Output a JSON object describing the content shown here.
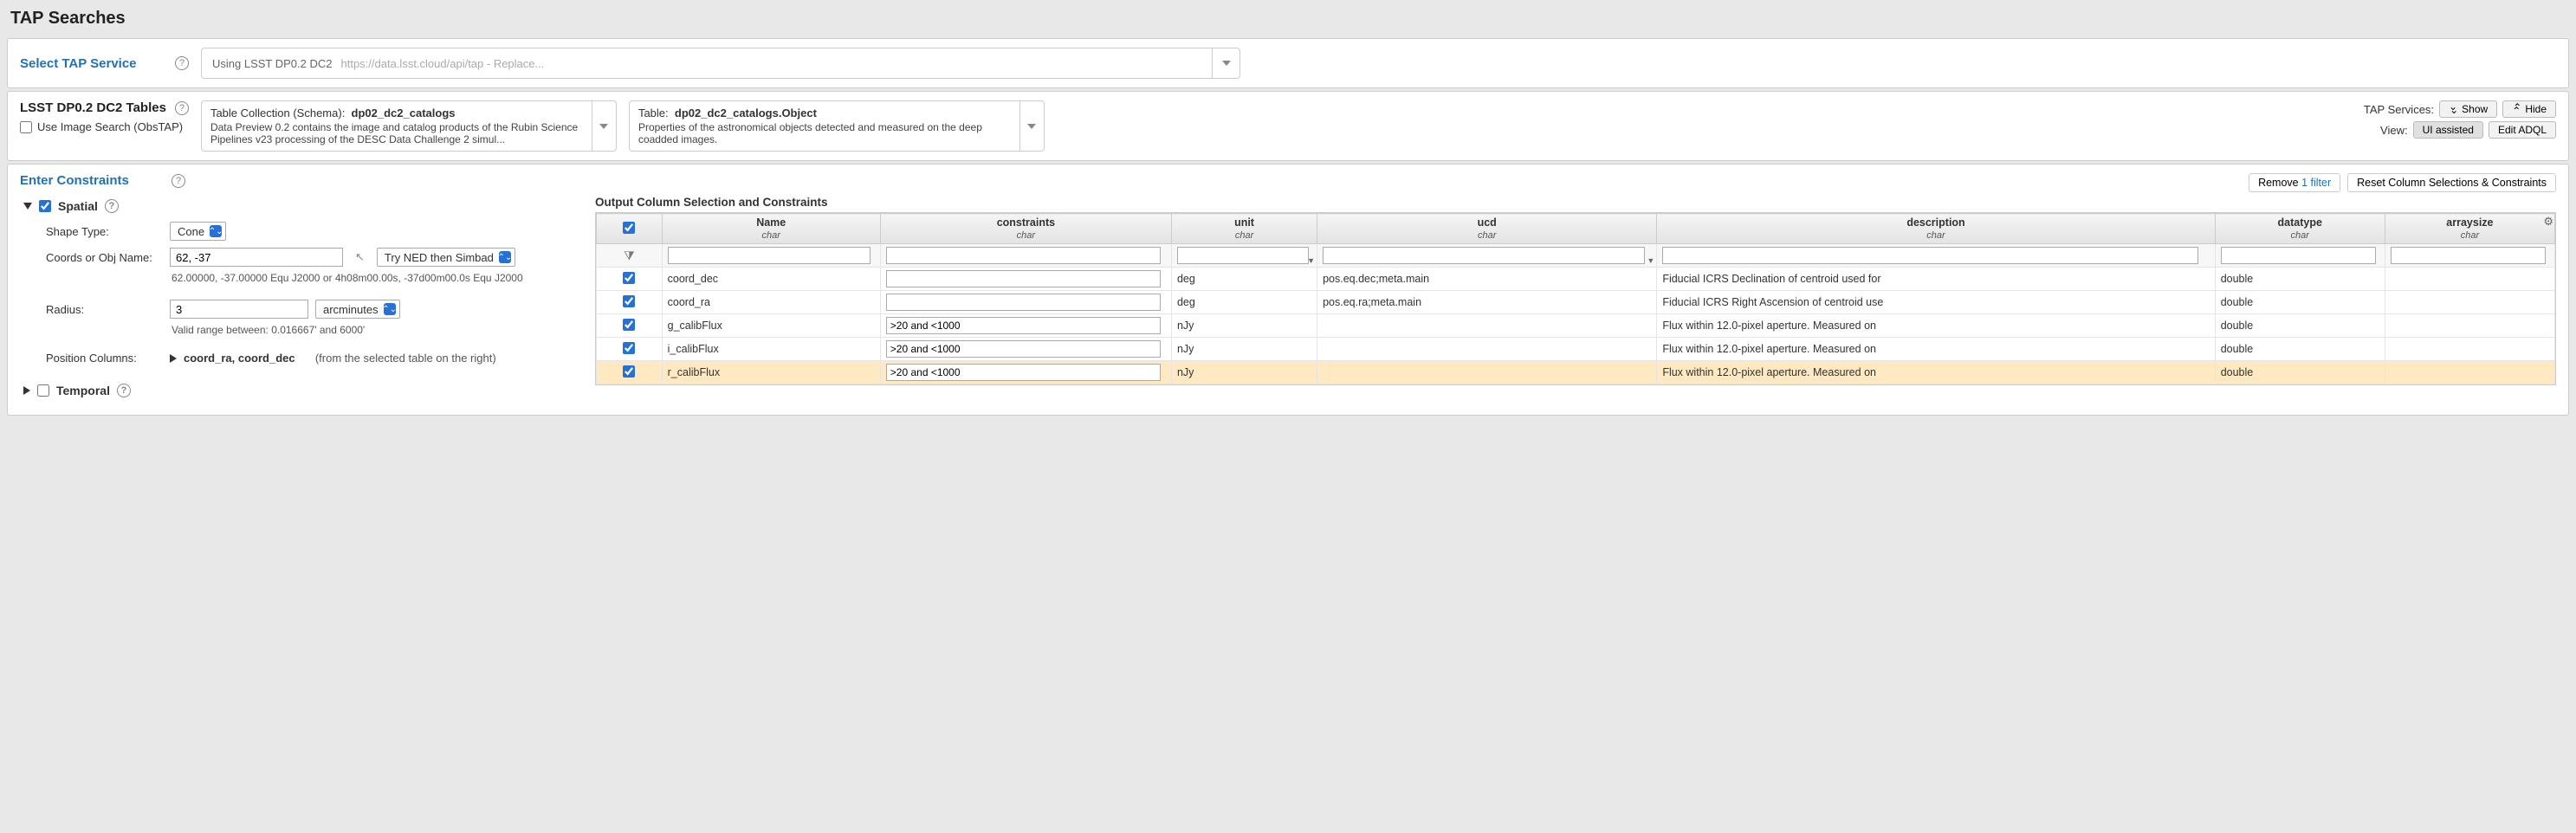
{
  "page_title": "TAP Searches",
  "select_service": {
    "label": "Select TAP Service",
    "prefix": "Using LSST DP0.2 DC2",
    "url_placeholder": "https://data.lsst.cloud/api/tap - Replace..."
  },
  "tables_section": {
    "label": "LSST DP0.2 DC2 Tables",
    "obstap_label": "Use Image Search (ObsTAP)",
    "schema_box": {
      "prefix": "Table Collection (Schema):",
      "name": "dp02_dc2_catalogs",
      "desc": "Data Preview 0.2 contains the image and catalog products of the Rubin Science Pipelines v23 processing of the DESC Data Challenge 2 simul..."
    },
    "table_box": {
      "prefix": "Table:",
      "name": "dp02_dc2_catalogs.Object",
      "desc": "Properties of the astronomical objects detected and measured on the deep coadded images."
    },
    "tap_services_label": "TAP Services:",
    "show_btn": "Show",
    "hide_btn": "Hide",
    "view_label": "View:",
    "ui_assisted_btn": "UI assisted",
    "edit_adql_btn": "Edit ADQL"
  },
  "constraints_section": {
    "label": "Enter Constraints",
    "remove_filter_prefix": "Remove ",
    "remove_filter_link": "1 filter",
    "reset_btn": "Reset Column Selections & Constraints",
    "spatial_label": "Spatial",
    "temporal_label": "Temporal",
    "shape_type_label": "Shape Type:",
    "shape_type_value": "Cone",
    "coords_label": "Coords or Obj Name:",
    "coords_value": "62, -37",
    "try_btn": "Try NED then Simbad",
    "coords_note": "62.00000, -37.00000  Equ J2000   or   4h08m00.00s, -37d00m00.0s  Equ J2000",
    "radius_label": "Radius:",
    "radius_value": "3",
    "radius_unit": "arcminutes",
    "radius_note": "Valid range between: 0.016667' and 6000'",
    "position_cols_label": "Position Columns:",
    "position_cols_value": "coord_ra, coord_dec",
    "position_cols_note": "(from the selected table on the right)"
  },
  "output_table": {
    "header": "Output Column Selection and Constraints",
    "columns": [
      {
        "name": "Name",
        "type": "char"
      },
      {
        "name": "constraints",
        "type": "char"
      },
      {
        "name": "unit",
        "type": "char"
      },
      {
        "name": "ucd",
        "type": "char"
      },
      {
        "name": "description",
        "type": "char"
      },
      {
        "name": "datatype",
        "type": "char"
      },
      {
        "name": "arraysize",
        "type": "char"
      }
    ],
    "rows": [
      {
        "checked": true,
        "name": "coord_dec",
        "constraints": "",
        "unit": "deg",
        "ucd": "pos.eq.dec;meta.main",
        "description": "Fiducial ICRS Declination of centroid used for",
        "datatype": "double",
        "highlight": false
      },
      {
        "checked": true,
        "name": "coord_ra",
        "constraints": "",
        "unit": "deg",
        "ucd": "pos.eq.ra;meta.main",
        "description": "Fiducial ICRS Right Ascension of centroid use",
        "datatype": "double",
        "highlight": false
      },
      {
        "checked": true,
        "name": "g_calibFlux",
        "constraints": ">20 and <1000",
        "unit": "nJy",
        "ucd": "",
        "description": "Flux within 12.0-pixel aperture. Measured on",
        "datatype": "double",
        "highlight": false
      },
      {
        "checked": true,
        "name": "i_calibFlux",
        "constraints": ">20 and <1000",
        "unit": "nJy",
        "ucd": "",
        "description": "Flux within 12.0-pixel aperture. Measured on",
        "datatype": "double",
        "highlight": false
      },
      {
        "checked": true,
        "name": "r_calibFlux",
        "constraints": ">20 and <1000",
        "unit": "nJy",
        "ucd": "",
        "description": "Flux within 12.0-pixel aperture. Measured on",
        "datatype": "double",
        "highlight": true
      }
    ]
  }
}
